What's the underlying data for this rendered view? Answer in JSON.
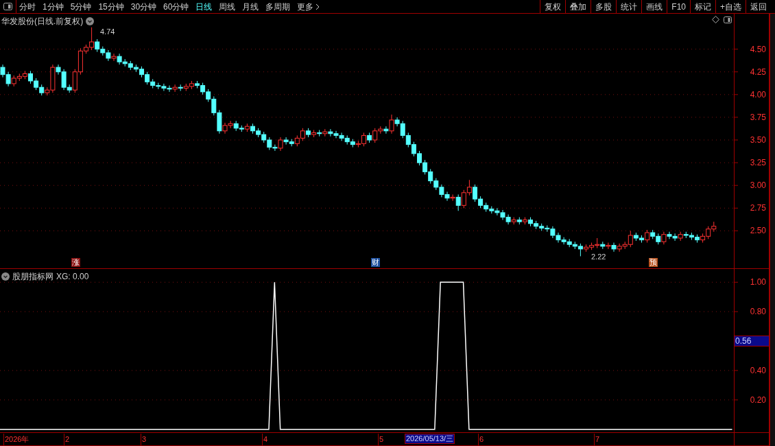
{
  "toolbar": {
    "periods": [
      {
        "label": "分时",
        "selected": false
      },
      {
        "label": "1分钟",
        "selected": false
      },
      {
        "label": "5分钟",
        "selected": false
      },
      {
        "label": "15分钟",
        "selected": false
      },
      {
        "label": "30分钟",
        "selected": false
      },
      {
        "label": "60分钟",
        "selected": false
      },
      {
        "label": "日线",
        "selected": true
      },
      {
        "label": "周线",
        "selected": false
      },
      {
        "label": "月线",
        "selected": false
      },
      {
        "label": "多周期",
        "selected": false
      },
      {
        "label": "更多",
        "selected": false
      }
    ],
    "buttons": [
      "复权",
      "叠加",
      "多股",
      "统计",
      "画线",
      "F10",
      "标记",
      "+自选",
      "返回"
    ]
  },
  "price_chart": {
    "title": "华发股份(日线.前复权)",
    "high_label": "4.74",
    "low_label": "2.22",
    "markers": [
      {
        "label": "涨",
        "color": "#8b1010"
      },
      {
        "label": "财",
        "color": "#1d4f9e"
      },
      {
        "label": "预",
        "color": "#b8501c"
      }
    ],
    "chart_data": {
      "type": "candlestick",
      "grid": true,
      "ylim": [
        2.08,
        4.89
      ],
      "yticks": [
        {
          "value": 4.5,
          "label": "4.50"
        },
        {
          "value": 4.25,
          "label": "4.25"
        },
        {
          "value": 4.0,
          "label": "4.00"
        },
        {
          "value": 3.75,
          "label": "3.75"
        },
        {
          "value": 3.5,
          "label": "3.50"
        },
        {
          "value": 3.25,
          "label": "3.25"
        },
        {
          "value": 3.0,
          "label": "3.00"
        },
        {
          "value": 2.75,
          "label": "2.75"
        },
        {
          "value": 2.5,
          "label": "2.50"
        }
      ],
      "ohlc": [
        [
          4.3,
          4.33,
          4.19,
          4.22
        ],
        [
          4.22,
          4.25,
          4.09,
          4.12
        ],
        [
          4.12,
          4.21,
          4.09,
          4.18
        ],
        [
          4.18,
          4.23,
          4.15,
          4.2
        ],
        [
          4.2,
          4.26,
          4.17,
          4.23
        ],
        [
          4.23,
          4.26,
          4.12,
          4.15
        ],
        [
          4.15,
          4.18,
          4.05,
          4.08
        ],
        [
          4.08,
          4.11,
          3.99,
          4.02
        ],
        [
          4.02,
          4.08,
          3.99,
          4.05
        ],
        [
          4.05,
          4.33,
          4.02,
          4.3
        ],
        [
          4.3,
          4.33,
          4.22,
          4.25
        ],
        [
          4.25,
          4.28,
          4.05,
          4.08
        ],
        [
          4.08,
          4.11,
          4.02,
          4.05
        ],
        [
          4.05,
          4.28,
          4.02,
          4.25
        ],
        [
          4.25,
          4.51,
          4.22,
          4.48
        ],
        [
          4.48,
          4.55,
          4.45,
          4.52
        ],
        [
          4.52,
          4.74,
          4.49,
          4.58
        ],
        [
          4.58,
          4.61,
          4.47,
          4.5
        ],
        [
          4.5,
          4.53,
          4.43,
          4.46
        ],
        [
          4.46,
          4.49,
          4.37,
          4.4
        ],
        [
          4.4,
          4.45,
          4.37,
          4.42
        ],
        [
          4.42,
          4.45,
          4.33,
          4.36
        ],
        [
          4.36,
          4.39,
          4.31,
          4.34
        ],
        [
          4.34,
          4.37,
          4.27,
          4.3
        ],
        [
          4.3,
          4.33,
          4.25,
          4.28
        ],
        [
          4.28,
          4.31,
          4.19,
          4.22
        ],
        [
          4.22,
          4.25,
          4.11,
          4.14
        ],
        [
          4.14,
          4.17,
          4.07,
          4.1
        ],
        [
          4.1,
          4.13,
          4.06,
          4.09
        ],
        [
          4.09,
          4.12,
          4.04,
          4.07
        ],
        [
          4.07,
          4.1,
          4.03,
          4.06
        ],
        [
          4.06,
          4.11,
          4.03,
          4.08
        ],
        [
          4.08,
          4.11,
          4.04,
          4.07
        ],
        [
          4.07,
          4.12,
          4.04,
          4.09
        ],
        [
          4.09,
          4.15,
          4.06,
          4.12
        ],
        [
          4.12,
          4.15,
          4.07,
          4.1
        ],
        [
          4.1,
          4.13,
          4.0,
          4.03
        ],
        [
          4.03,
          4.06,
          3.92,
          3.95
        ],
        [
          3.95,
          3.98,
          3.77,
          3.8
        ],
        [
          3.8,
          3.83,
          3.57,
          3.6
        ],
        [
          3.6,
          3.69,
          3.57,
          3.66
        ],
        [
          3.66,
          3.71,
          3.63,
          3.68
        ],
        [
          3.68,
          3.71,
          3.6,
          3.63
        ],
        [
          3.63,
          3.66,
          3.59,
          3.62
        ],
        [
          3.62,
          3.68,
          3.59,
          3.65
        ],
        [
          3.65,
          3.68,
          3.57,
          3.6
        ],
        [
          3.6,
          3.63,
          3.53,
          3.56
        ],
        [
          3.56,
          3.59,
          3.47,
          3.5
        ],
        [
          3.5,
          3.53,
          3.39,
          3.42
        ],
        [
          3.42,
          3.45,
          3.38,
          3.41
        ],
        [
          3.41,
          3.53,
          3.38,
          3.5
        ],
        [
          3.5,
          3.53,
          3.45,
          3.48
        ],
        [
          3.48,
          3.51,
          3.43,
          3.46
        ],
        [
          3.46,
          3.55,
          3.43,
          3.52
        ],
        [
          3.52,
          3.63,
          3.49,
          3.6
        ],
        [
          3.6,
          3.63,
          3.53,
          3.56
        ],
        [
          3.56,
          3.61,
          3.53,
          3.58
        ],
        [
          3.58,
          3.61,
          3.54,
          3.57
        ],
        [
          3.57,
          3.62,
          3.54,
          3.59
        ],
        [
          3.59,
          3.62,
          3.54,
          3.57
        ],
        [
          3.57,
          3.6,
          3.52,
          3.55
        ],
        [
          3.55,
          3.58,
          3.49,
          3.52
        ],
        [
          3.52,
          3.55,
          3.45,
          3.48
        ],
        [
          3.48,
          3.51,
          3.42,
          3.45
        ],
        [
          3.45,
          3.49,
          3.42,
          3.46
        ],
        [
          3.46,
          3.58,
          3.43,
          3.55
        ],
        [
          3.55,
          3.58,
          3.47,
          3.5
        ],
        [
          3.5,
          3.63,
          3.47,
          3.6
        ],
        [
          3.6,
          3.65,
          3.57,
          3.62
        ],
        [
          3.62,
          3.65,
          3.57,
          3.6
        ],
        [
          3.6,
          3.78,
          3.57,
          3.72
        ],
        [
          3.72,
          3.75,
          3.65,
          3.68
        ],
        [
          3.68,
          3.71,
          3.52,
          3.55
        ],
        [
          3.55,
          3.58,
          3.42,
          3.45
        ],
        [
          3.45,
          3.48,
          3.32,
          3.35
        ],
        [
          3.35,
          3.38,
          3.22,
          3.25
        ],
        [
          3.25,
          3.28,
          3.12,
          3.15
        ],
        [
          3.15,
          3.18,
          3.02,
          3.05
        ],
        [
          3.05,
          3.08,
          2.95,
          2.98
        ],
        [
          2.98,
          3.01,
          2.87,
          2.9
        ],
        [
          2.9,
          2.93,
          2.83,
          2.86
        ],
        [
          2.86,
          2.9,
          2.83,
          2.87
        ],
        [
          2.87,
          2.9,
          2.72,
          2.78
        ],
        [
          2.78,
          2.95,
          2.75,
          2.92
        ],
        [
          2.92,
          3.06,
          2.89,
          2.98
        ],
        [
          2.98,
          3.01,
          2.82,
          2.85
        ],
        [
          2.85,
          2.88,
          2.75,
          2.78
        ],
        [
          2.78,
          2.81,
          2.71,
          2.74
        ],
        [
          2.74,
          2.77,
          2.69,
          2.72
        ],
        [
          2.72,
          2.75,
          2.67,
          2.7
        ],
        [
          2.7,
          2.73,
          2.62,
          2.65
        ],
        [
          2.65,
          2.68,
          2.57,
          2.6
        ],
        [
          2.6,
          2.65,
          2.57,
          2.62
        ],
        [
          2.62,
          2.65,
          2.57,
          2.6
        ],
        [
          2.6,
          2.65,
          2.57,
          2.62
        ],
        [
          2.62,
          2.65,
          2.55,
          2.58
        ],
        [
          2.58,
          2.61,
          2.52,
          2.55
        ],
        [
          2.55,
          2.58,
          2.5,
          2.53
        ],
        [
          2.53,
          2.56,
          2.49,
          2.52
        ],
        [
          2.52,
          2.55,
          2.42,
          2.45
        ],
        [
          2.45,
          2.48,
          2.37,
          2.4
        ],
        [
          2.4,
          2.43,
          2.35,
          2.38
        ],
        [
          2.38,
          2.41,
          2.32,
          2.35
        ],
        [
          2.35,
          2.38,
          2.3,
          2.33
        ],
        [
          2.33,
          2.36,
          2.22,
          2.3
        ],
        [
          2.3,
          2.35,
          2.27,
          2.32
        ],
        [
          2.32,
          2.37,
          2.29,
          2.34
        ],
        [
          2.34,
          2.42,
          2.31,
          2.35
        ],
        [
          2.35,
          2.38,
          2.3,
          2.33
        ],
        [
          2.33,
          2.37,
          2.3,
          2.34
        ],
        [
          2.34,
          2.37,
          2.27,
          2.3
        ],
        [
          2.3,
          2.36,
          2.27,
          2.33
        ],
        [
          2.33,
          2.38,
          2.3,
          2.35
        ],
        [
          2.35,
          2.5,
          2.32,
          2.45
        ],
        [
          2.45,
          2.48,
          2.39,
          2.42
        ],
        [
          2.42,
          2.45,
          2.37,
          2.4
        ],
        [
          2.4,
          2.51,
          2.37,
          2.48
        ],
        [
          2.48,
          2.51,
          2.41,
          2.44
        ],
        [
          2.44,
          2.47,
          2.35,
          2.38
        ],
        [
          2.38,
          2.49,
          2.35,
          2.46
        ],
        [
          2.46,
          2.49,
          2.41,
          2.44
        ],
        [
          2.44,
          2.47,
          2.39,
          2.42
        ],
        [
          2.42,
          2.49,
          2.39,
          2.46
        ],
        [
          2.46,
          2.49,
          2.42,
          2.45
        ],
        [
          2.45,
          2.48,
          2.4,
          2.43
        ],
        [
          2.43,
          2.46,
          2.37,
          2.4
        ],
        [
          2.4,
          2.47,
          2.37,
          2.44
        ],
        [
          2.44,
          2.55,
          2.41,
          2.52
        ],
        [
          2.52,
          2.6,
          2.49,
          2.55
        ]
      ]
    }
  },
  "indicator": {
    "title": "股朋指标网",
    "reading": ": 0.00",
    "cursor_value": "0.56",
    "chart_data": {
      "type": "line",
      "grid": true,
      "ylim": [
        -0.02,
        1.09
      ],
      "yticks": [
        {
          "value": 0.2,
          "label": "0.20"
        },
        {
          "value": 0.4,
          "label": "0.40"
        },
        {
          "value": 0.8,
          "label": "0.80"
        },
        {
          "value": 1.0,
          "label": "1.00"
        }
      ],
      "series": [
        {
          "name": "XG",
          "color": "#ffffff",
          "values": [
            0,
            0,
            0,
            0,
            0,
            0,
            0,
            0,
            0,
            0,
            0,
            0,
            0,
            0,
            0,
            0,
            0,
            0,
            0,
            0,
            0,
            0,
            0,
            0,
            0,
            0,
            0,
            0,
            0,
            0,
            0,
            0,
            0,
            0,
            0,
            0,
            0,
            0,
            0,
            0,
            0,
            0,
            0,
            0,
            0,
            0,
            0,
            0,
            1,
            0,
            0,
            0,
            0,
            0,
            0,
            0,
            0,
            0,
            0,
            0,
            0,
            0,
            0,
            0,
            0,
            0,
            0,
            0,
            0,
            0,
            0,
            0,
            0,
            0,
            0,
            0,
            0,
            1,
            1,
            1,
            1,
            1,
            0,
            0,
            0,
            0,
            0,
            0,
            0,
            0,
            0,
            0,
            0,
            0,
            0,
            0,
            0,
            0,
            0,
            0,
            0,
            0,
            0,
            0,
            0,
            0,
            0,
            0,
            0,
            0,
            0,
            0,
            0,
            0,
            0,
            0,
            0,
            0,
            0,
            0,
            0,
            0,
            0,
            0,
            0,
            0,
            0,
            0,
            0
          ]
        }
      ]
    }
  },
  "date_axis": {
    "labels": [
      "2026年",
      "2",
      "3",
      "4",
      "5",
      "6",
      "7"
    ],
    "cursor_date": "2026/05/13/三"
  }
}
